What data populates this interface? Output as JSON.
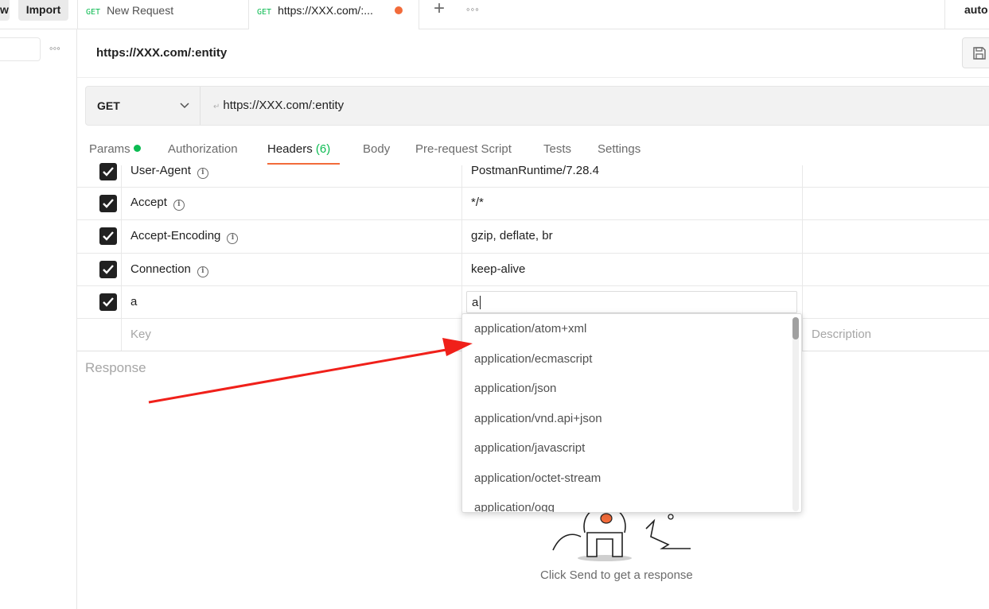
{
  "topbar": {
    "frag_label": "w",
    "import_label": "Import",
    "tabs": [
      {
        "method": "GET",
        "title": "New Request"
      },
      {
        "method": "GET",
        "title": "https://XXX.com/:..."
      }
    ],
    "env_fragment": "auto"
  },
  "request": {
    "title": "https://XXX.com/:entity",
    "method": "GET",
    "url": "https://XXX.com/:entity"
  },
  "req_tabs": {
    "params": "Params",
    "authorization": "Authorization",
    "headers": "Headers",
    "headers_count": "(6)",
    "body": "Body",
    "prerequest": "Pre-request Script",
    "tests": "Tests",
    "settings": "Settings"
  },
  "headers": {
    "rows": [
      {
        "key": "User-Agent",
        "value": "PostmanRuntime/7.28.4",
        "checked": true
      },
      {
        "key": "Accept",
        "value": "*/*",
        "checked": true
      },
      {
        "key": "Accept-Encoding",
        "value": "gzip, deflate, br",
        "checked": true
      },
      {
        "key": "Connection",
        "value": "keep-alive",
        "checked": true
      },
      {
        "key": "a",
        "value": "a",
        "checked": true
      }
    ],
    "key_placeholder": "Key",
    "description_placeholder": "Description"
  },
  "autocomplete": {
    "items": [
      "application/atom+xml",
      "application/ecmascript",
      "application/json",
      "application/vnd.api+json",
      "application/javascript",
      "application/octet-stream",
      "application/ogg"
    ]
  },
  "response": {
    "title": "Response",
    "hint": "Click Send to get a response"
  },
  "colors": {
    "accent": "#f26b3a",
    "get_method": "#0cbb52",
    "annotation_arrow": "#f0201a"
  }
}
